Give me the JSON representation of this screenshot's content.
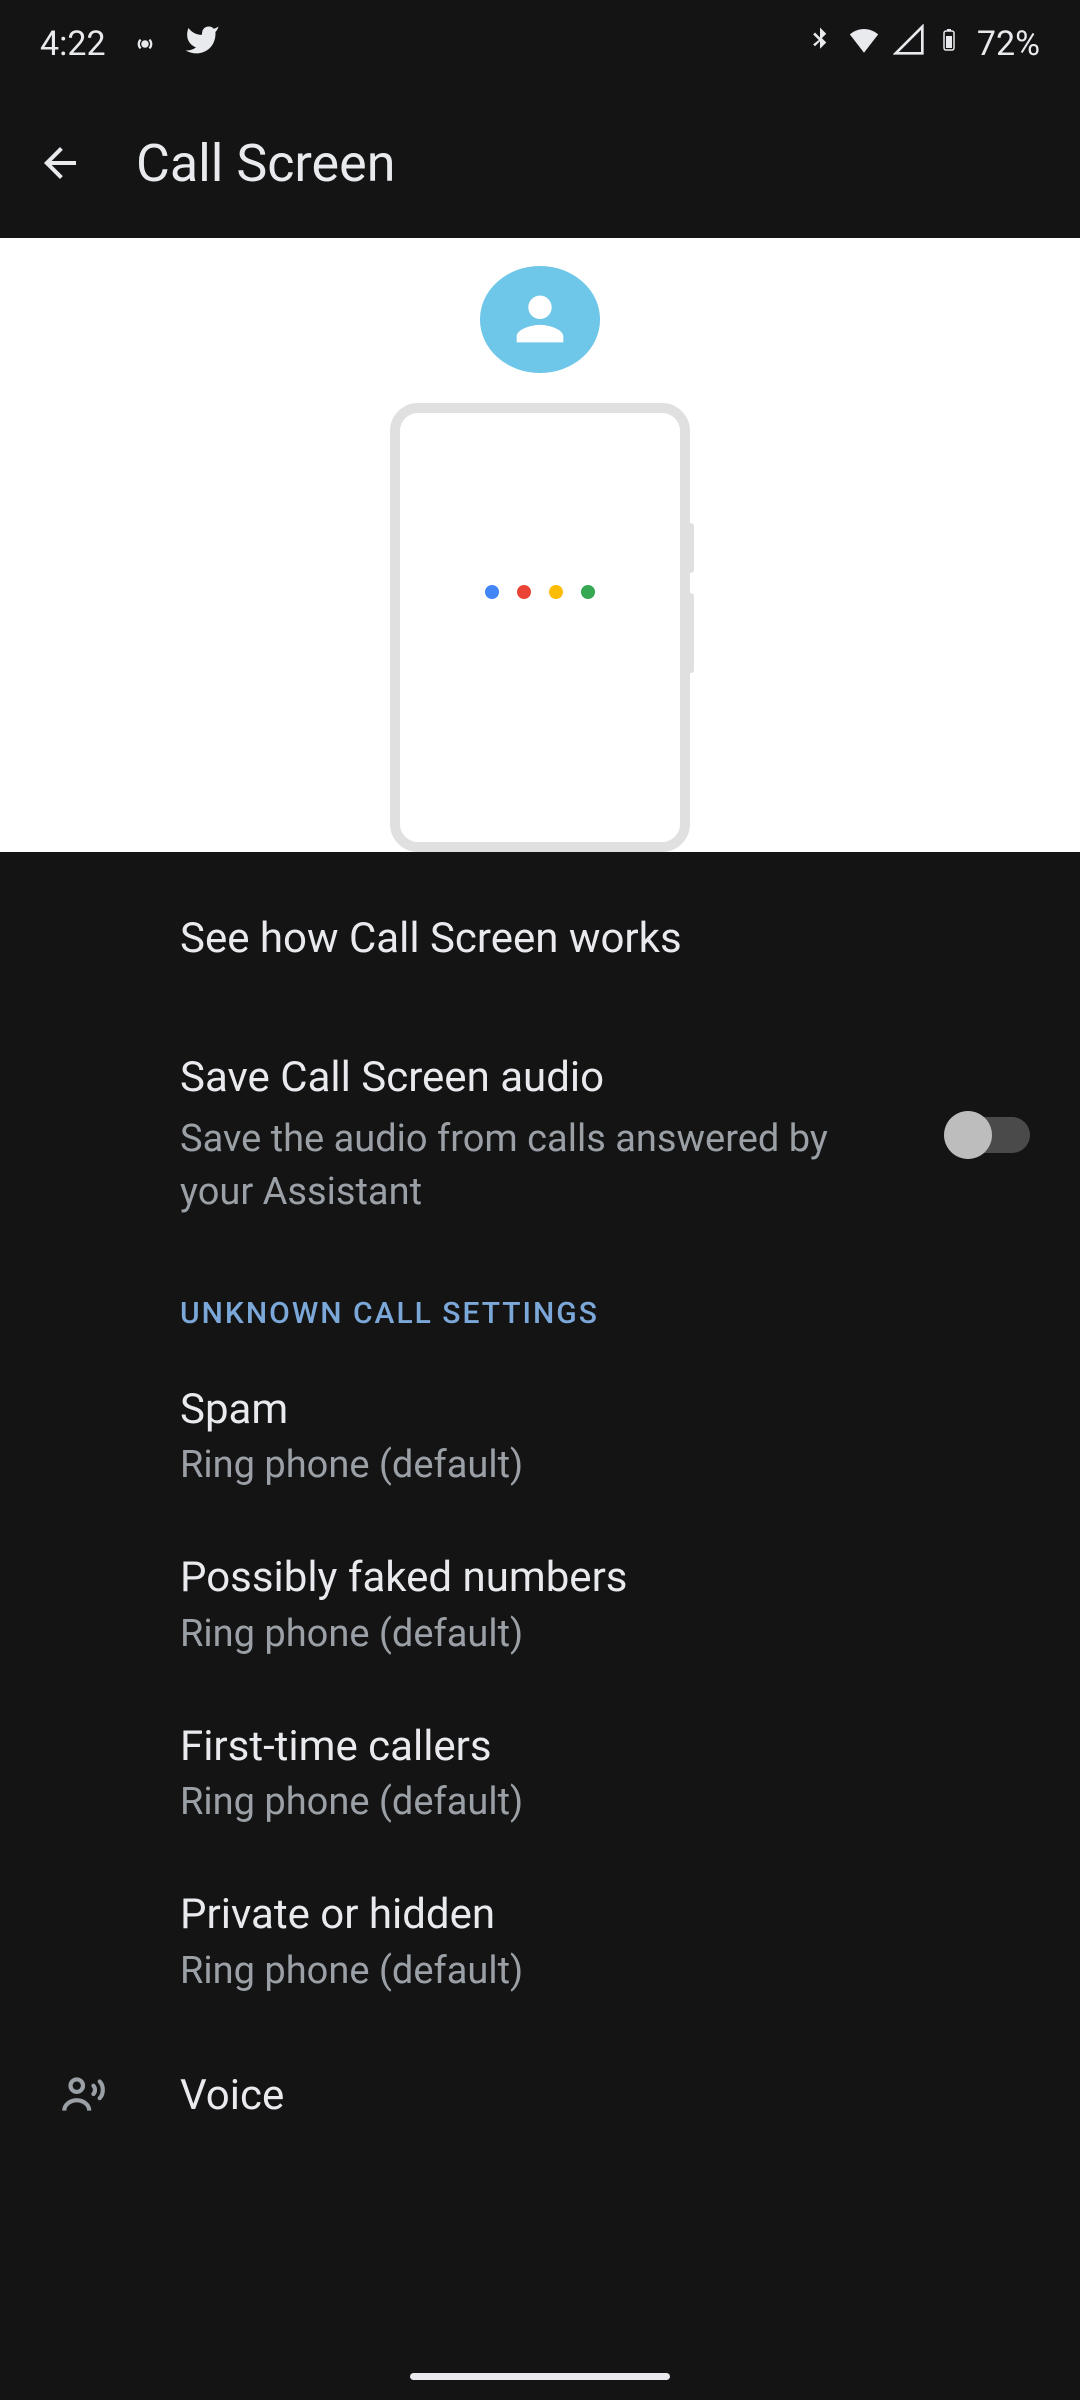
{
  "status": {
    "time": "4:22",
    "battery": "72%"
  },
  "appbar": {
    "title": "Call Screen"
  },
  "settings": {
    "howItWorks": "See how Call Screen works",
    "saveAudio": {
      "title": "Save Call Screen audio",
      "subtitle": "Save the audio from calls answered by your Assistant"
    },
    "sectionHeader": "UNKNOWN CALL SETTINGS",
    "categories": [
      {
        "title": "Spam",
        "value": "Ring phone (default)"
      },
      {
        "title": "Possibly faked numbers",
        "value": "Ring phone (default)"
      },
      {
        "title": "First-time callers",
        "value": "Ring phone (default)"
      },
      {
        "title": "Private or hidden",
        "value": "Ring phone (default)"
      }
    ],
    "voice": "Voice"
  }
}
